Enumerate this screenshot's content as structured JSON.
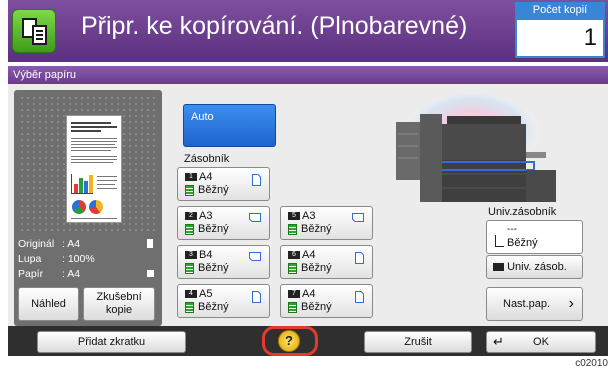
{
  "header": {
    "title": "Připr. ke kopírování. (Plnobarevné)",
    "copies_label": "Počet kopií",
    "copies_value": "1"
  },
  "panel": {
    "title": "Výběr papíru"
  },
  "preview": {
    "original_label": "Originál",
    "original_value": ": A4",
    "zoom_label": "Lupa",
    "zoom_value": ": 100%",
    "paper_label": "Papír",
    "paper_value": ": A4",
    "preview_button": "Náhled",
    "test_copy_line1": "Zkušební",
    "test_copy_line2": "kopie"
  },
  "trays": {
    "auto_label": "Auto",
    "cassette_label": "Zásobník",
    "items": [
      {
        "num": "1",
        "size": "A4",
        "type": "Běžný"
      },
      {
        "num": "2",
        "size": "A3",
        "type": "Běžný"
      },
      {
        "num": "3",
        "size": "B4",
        "type": "Běžný"
      },
      {
        "num": "4",
        "size": "A5",
        "type": "Běžný"
      },
      {
        "num": "5",
        "size": "A3",
        "type": "Běžný"
      },
      {
        "num": "6",
        "size": "A4",
        "type": "Běžný"
      },
      {
        "num": "7",
        "size": "A4",
        "type": "Běžný"
      }
    ]
  },
  "mp_tray": {
    "label": "Univ.zásobník",
    "size": "---",
    "type": "Běžný",
    "button_label": "Univ. zásob.",
    "settings_button": "Nast.pap."
  },
  "bottom": {
    "add_shortcut": "Přidat zkratku",
    "help": "?",
    "cancel": "Zrušit",
    "ok": "OK"
  },
  "footer_code": "c02010"
}
